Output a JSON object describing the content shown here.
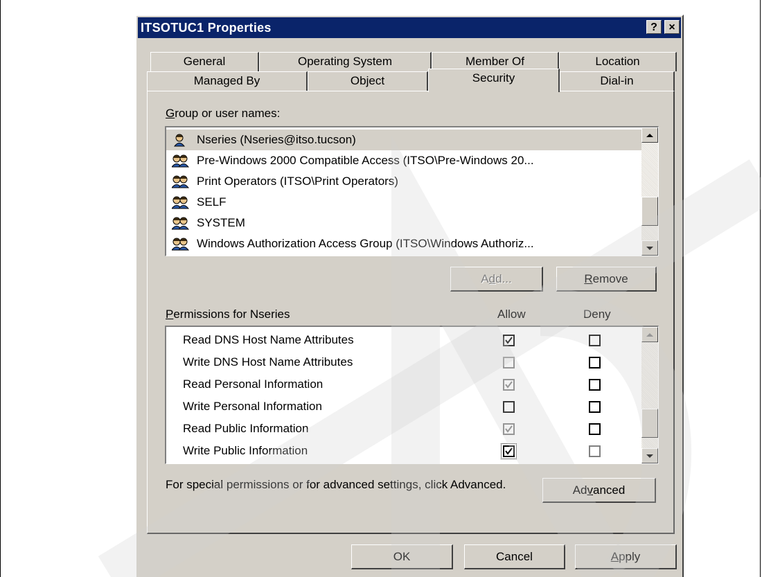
{
  "dialog": {
    "title": "ITSOTUC1 Properties",
    "help_button": "?",
    "close_button": "×"
  },
  "tabs_row1": [
    {
      "label": "General"
    },
    {
      "label": "Operating System"
    },
    {
      "label": "Member Of"
    },
    {
      "label": "Location"
    }
  ],
  "tabs_row2": [
    {
      "label": "Managed By"
    },
    {
      "label": "Object"
    },
    {
      "label": "Security"
    },
    {
      "label": "Dial-in"
    }
  ],
  "group_label": "Group or user names:",
  "group_list": [
    {
      "name": "Nseries (Nseries@itso.tucson)",
      "icon": "user-icon",
      "selected": true
    },
    {
      "name": "Pre-Windows 2000 Compatible Access (ITSO\\Pre-Windows 20...",
      "icon": "group-icon"
    },
    {
      "name": "Print Operators (ITSO\\Print Operators)",
      "icon": "group-icon"
    },
    {
      "name": "SELF",
      "icon": "group-icon"
    },
    {
      "name": "SYSTEM",
      "icon": "group-icon"
    },
    {
      "name": "Windows Authorization Access Group (ITSO\\Windows Authoriz...",
      "icon": "group-icon"
    }
  ],
  "buttons": {
    "add": "Add...",
    "remove": "Remove",
    "advanced": "Advanced",
    "ok": "OK",
    "cancel": "Cancel",
    "apply": "Apply"
  },
  "permissions": {
    "label": "Permissions for Nseries",
    "allow_header": "Allow",
    "deny_header": "Deny",
    "rows": [
      {
        "name": "Read DNS Host Name Attributes",
        "allow": true,
        "allow_gray": false,
        "deny": false,
        "deny_gray": false
      },
      {
        "name": "Write DNS Host Name Attributes",
        "allow": false,
        "allow_gray": true,
        "deny": false,
        "deny_gray": false
      },
      {
        "name": "Read Personal Information",
        "allow": true,
        "allow_gray": true,
        "deny": false,
        "deny_gray": false
      },
      {
        "name": "Write Personal Information",
        "allow": false,
        "allow_gray": false,
        "deny": false,
        "deny_gray": false
      },
      {
        "name": "Read Public Information",
        "allow": true,
        "allow_gray": true,
        "deny": false,
        "deny_gray": false
      },
      {
        "name": "Write Public Information",
        "allow": true,
        "allow_gray": false,
        "deny": false,
        "deny_gray": true
      }
    ]
  },
  "advanced_text": "For special permissions or for advanced settings, click Advanced."
}
